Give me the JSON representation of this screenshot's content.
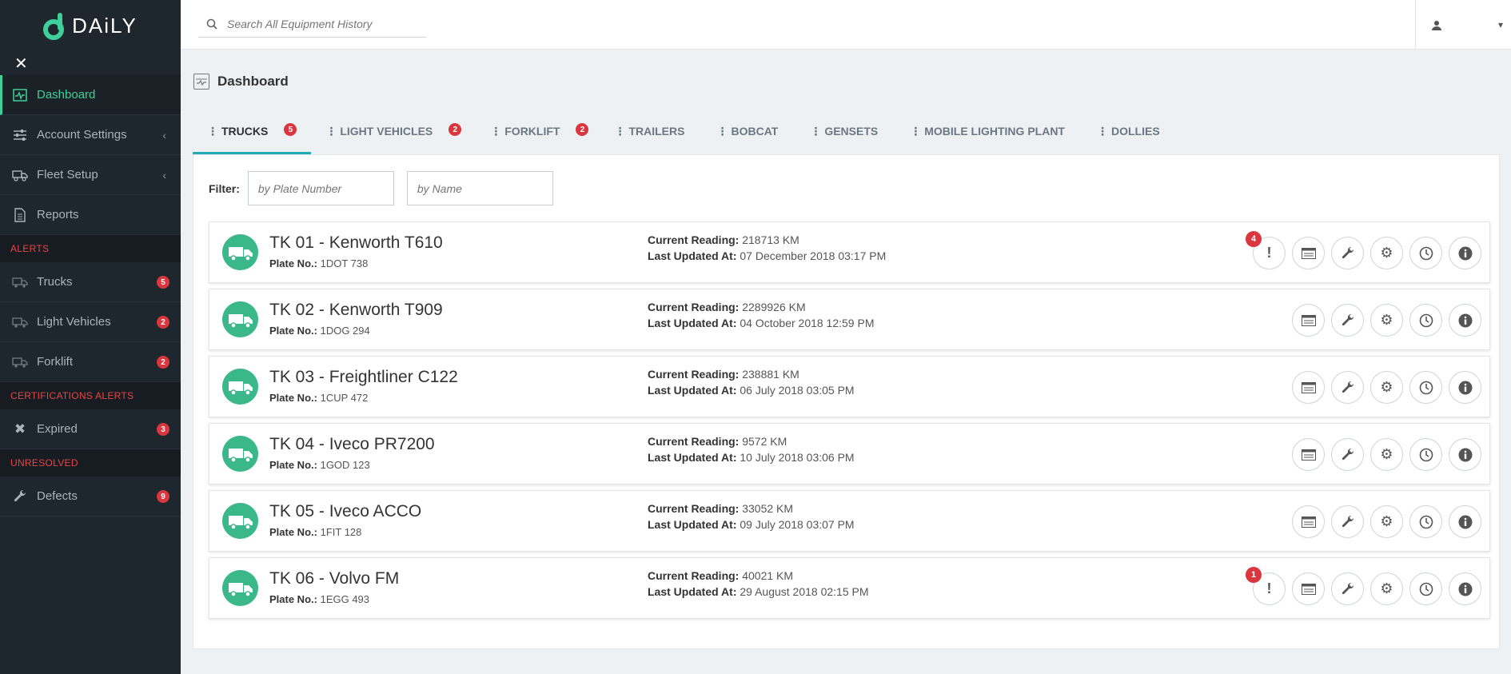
{
  "app": {
    "logo_text": "DAiLY"
  },
  "sidebar": {
    "close_glyph": "✕",
    "items": [
      {
        "label": "Dashboard",
        "icon": "dashboard-icon",
        "active": true
      },
      {
        "label": "Account Settings",
        "icon": "sliders-icon",
        "chevron": "‹"
      },
      {
        "label": "Fleet Setup",
        "icon": "truck-gear-icon",
        "chevron": "‹"
      },
      {
        "label": "Reports",
        "icon": "document-icon"
      }
    ],
    "alerts_title": "ALERTS",
    "alerts": [
      {
        "label": "Trucks",
        "count": "5"
      },
      {
        "label": "Light Vehicles",
        "count": "2"
      },
      {
        "label": "Forklift",
        "count": "2"
      }
    ],
    "cert_title": "CERTIFICATIONS ALERTS",
    "cert": [
      {
        "label": "Expired",
        "count": "3"
      }
    ],
    "unresolved_title": "UNRESOLVED",
    "unresolved": [
      {
        "label": "Defects",
        "count": "9"
      }
    ]
  },
  "topbar": {
    "search_placeholder": "Search All Equipment History",
    "user_caret": "▾"
  },
  "page": {
    "title": "Dashboard"
  },
  "tabs": [
    {
      "label": "TRUCKS",
      "badge": "5",
      "active": true
    },
    {
      "label": "LIGHT VEHICLES",
      "badge": "2"
    },
    {
      "label": "FORKLIFT",
      "badge": "2"
    },
    {
      "label": "TRAILERS"
    },
    {
      "label": "BOBCAT"
    },
    {
      "label": "GENSETS"
    },
    {
      "label": "MOBILE LIGHTING PLANT"
    },
    {
      "label": "DOLLIES"
    }
  ],
  "filter": {
    "label": "Filter:",
    "plate_placeholder": "by Plate Number",
    "name_placeholder": "by Name"
  },
  "labels": {
    "plate": "Plate No.:",
    "current_reading": "Current Reading:",
    "last_updated": "Last Updated At:"
  },
  "vehicles": [
    {
      "name": "TK 01 - Kenworth T610",
      "plate": "1DOT 738",
      "reading": "218713 KM",
      "updated": "07 December 2018 03:17 PM",
      "alerts": "4"
    },
    {
      "name": "TK 02 - Kenworth T909",
      "plate": "1DOG 294",
      "reading": "2289926 KM",
      "updated": "04 October 2018 12:59 PM",
      "alerts": ""
    },
    {
      "name": "TK 03 - Freightliner C122",
      "plate": "1CUP 472",
      "reading": "238881 KM",
      "updated": "06 July 2018 03:05 PM",
      "alerts": ""
    },
    {
      "name": "TK 04 - Iveco PR7200",
      "plate": "1GOD 123",
      "reading": "9572 KM",
      "updated": "10 July 2018 03:06 PM",
      "alerts": ""
    },
    {
      "name": "TK 05 - Iveco ACCO",
      "plate": "1FIT 128",
      "reading": "33052 KM",
      "updated": "09 July 2018 03:07 PM",
      "alerts": ""
    },
    {
      "name": "TK 06 - Volvo FM",
      "plate": "1EGG 493",
      "reading": "40021 KM",
      "updated": "29 August 2018 02:15 PM",
      "alerts": "1"
    }
  ],
  "colors": {
    "accent": "#3fcf9b",
    "sidebar": "#1f272e",
    "badge": "#d9363e",
    "avatar": "#3bb88a",
    "tab_underline": "#24aab4"
  }
}
